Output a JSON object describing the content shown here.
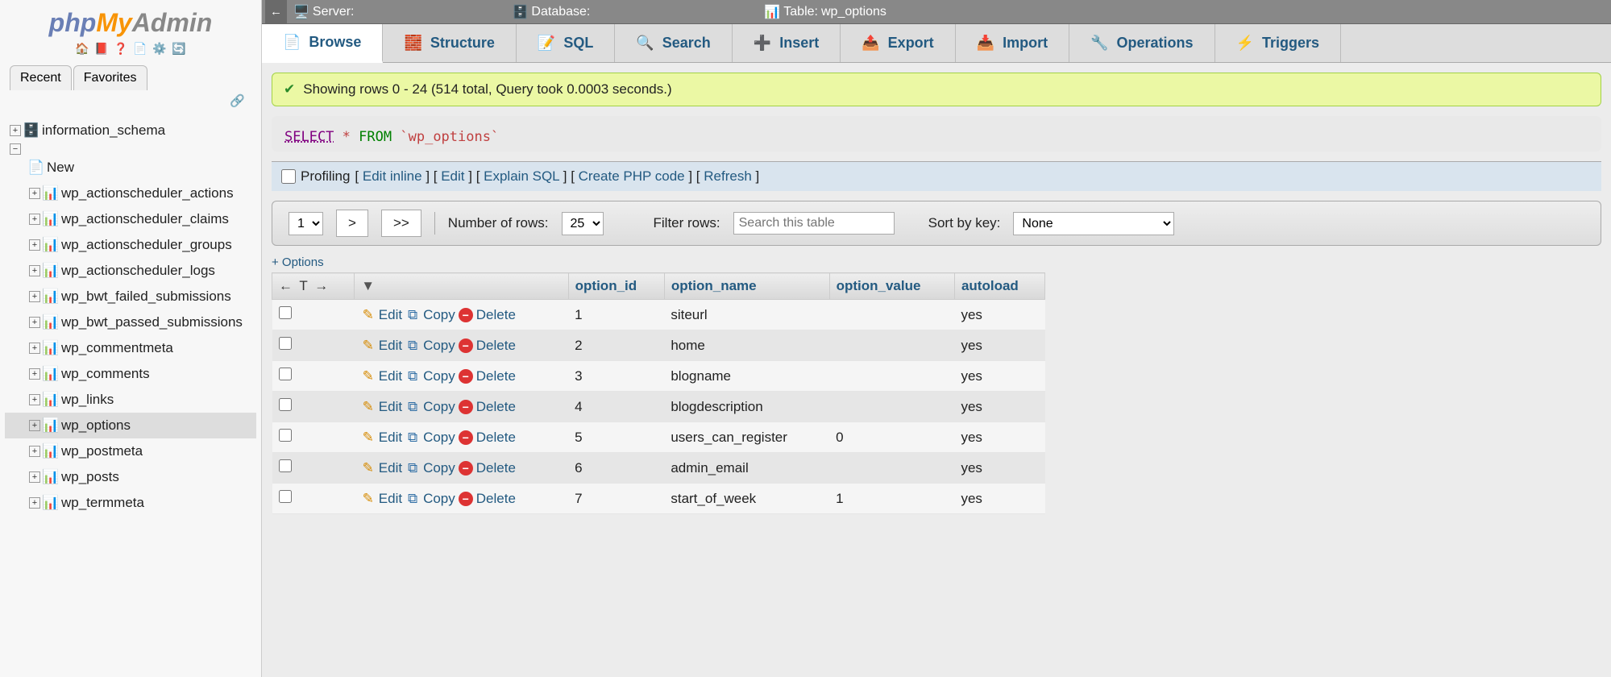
{
  "sidebar": {
    "tabs": {
      "recent": "Recent",
      "favorites": "Favorites"
    },
    "root_db": "information_schema",
    "new_label": "New",
    "tables": [
      "wp_actionscheduler_actions",
      "wp_actionscheduler_claims",
      "wp_actionscheduler_groups",
      "wp_actionscheduler_logs",
      "wp_bwt_failed_submissions",
      "wp_bwt_passed_submissions",
      "wp_commentmeta",
      "wp_comments",
      "wp_links",
      "wp_options",
      "wp_postmeta",
      "wp_posts",
      "wp_termmeta"
    ],
    "selected": "wp_options"
  },
  "breadcrumb": {
    "server_label": "Server:",
    "db_label": "Database:",
    "table_label": "Table:",
    "table_value": "wp_options"
  },
  "tabs": [
    "Browse",
    "Structure",
    "SQL",
    "Search",
    "Insert",
    "Export",
    "Import",
    "Operations",
    "Triggers"
  ],
  "tabs_active": "Browse",
  "success_msg": "Showing rows 0 - 24 (514 total, Query took 0.0003 seconds.)",
  "query": {
    "select": "SELECT",
    "star": "*",
    "from": "FROM",
    "table": "`wp_options`"
  },
  "query_actions": {
    "profiling": "Profiling",
    "links": [
      "Edit inline",
      "Edit",
      "Explain SQL",
      "Create PHP code",
      "Refresh"
    ]
  },
  "pager": {
    "page": "1",
    "next": ">",
    "last": ">>",
    "numrows_label": "Number of rows:",
    "numrows_value": "25",
    "filter_label": "Filter rows:",
    "filter_placeholder": "Search this table",
    "sort_label": "Sort by key:",
    "sort_value": "None"
  },
  "options_link": "+ Options",
  "table": {
    "columns": [
      "option_id",
      "option_name",
      "option_value",
      "autoload"
    ],
    "action_labels": {
      "edit": "Edit",
      "copy": "Copy",
      "delete": "Delete"
    },
    "rows": [
      {
        "option_id": "1",
        "option_name": "siteurl",
        "option_value": "",
        "autoload": "yes"
      },
      {
        "option_id": "2",
        "option_name": "home",
        "option_value": "",
        "autoload": "yes"
      },
      {
        "option_id": "3",
        "option_name": "blogname",
        "option_value": "",
        "autoload": "yes"
      },
      {
        "option_id": "4",
        "option_name": "blogdescription",
        "option_value": "",
        "autoload": "yes"
      },
      {
        "option_id": "5",
        "option_name": "users_can_register",
        "option_value": "0",
        "autoload": "yes"
      },
      {
        "option_id": "6",
        "option_name": "admin_email",
        "option_value": "",
        "autoload": "yes"
      },
      {
        "option_id": "7",
        "option_name": "start_of_week",
        "option_value": "1",
        "autoload": "yes"
      }
    ]
  }
}
